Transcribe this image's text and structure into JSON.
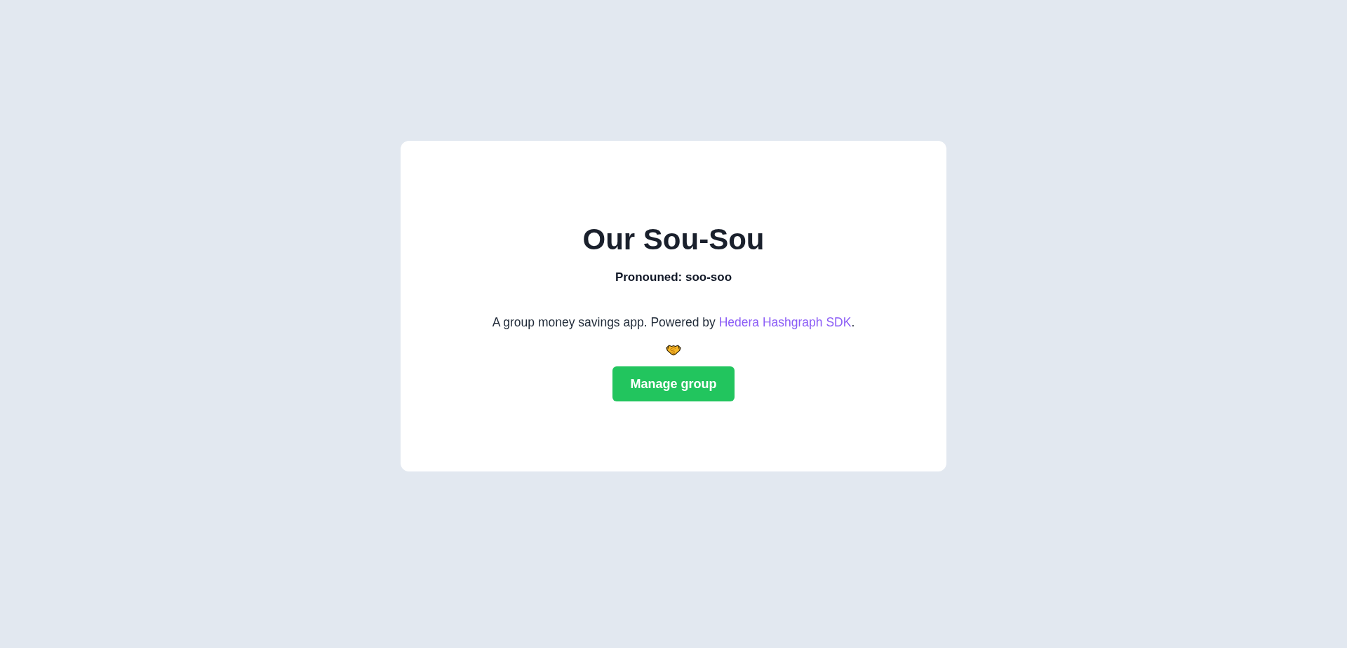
{
  "card": {
    "title": "Our Sou-Sou",
    "subtitle": "Pronouned: soo-soo",
    "description": {
      "text": "A group money savings app. Powered by ",
      "link": "Hedera Hashgraph SDK",
      "suffix": "."
    },
    "button": {
      "label": "Manage group"
    }
  }
}
